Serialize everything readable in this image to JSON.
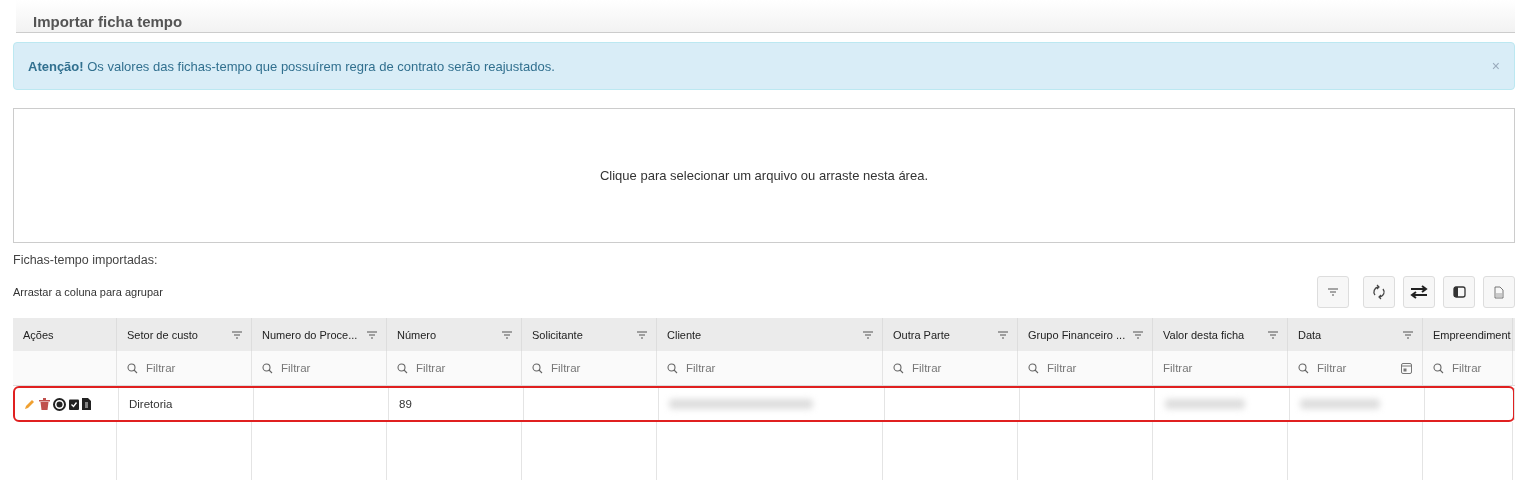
{
  "page_title": "Importar ficha tempo",
  "alert": {
    "strong": "Atenção!",
    "message": "Os valores das fichas-tempo que possuírem regra de contrato serão reajustados.",
    "close": "×"
  },
  "dropzone": {
    "text": "Clique para selecionar um arquivo ou arraste nesta área."
  },
  "section_label": "Fichas-tempo importadas:",
  "group_hint": "Arrastar a coluna para agrupar",
  "toolbar": [
    {
      "kind": "filter"
    },
    {
      "kind": "refresh"
    },
    {
      "kind": "swap"
    },
    {
      "kind": "columns"
    },
    {
      "kind": "export"
    }
  ],
  "table": {
    "columns": [
      {
        "label": "Ações",
        "menu": false
      },
      {
        "label": "Setor de custo",
        "menu": true,
        "search_icon": true,
        "calendar": false,
        "placeholder": "Filtrar"
      },
      {
        "label": "Numero do Proce...",
        "menu": true,
        "search_icon": true,
        "calendar": false,
        "placeholder": "Filtrar"
      },
      {
        "label": "Número",
        "menu": true,
        "search_icon": true,
        "calendar": false,
        "placeholder": "Filtrar"
      },
      {
        "label": "Solicitante",
        "menu": true,
        "search_icon": true,
        "calendar": false,
        "placeholder": "Filtrar"
      },
      {
        "label": "Cliente",
        "menu": true,
        "search_icon": true,
        "calendar": false,
        "placeholder": "Filtrar"
      },
      {
        "label": "Outra Parte",
        "menu": true,
        "search_icon": true,
        "calendar": false,
        "placeholder": "Filtrar"
      },
      {
        "label": "Grupo Financeiro ...",
        "menu": true,
        "search_icon": true,
        "calendar": false,
        "placeholder": "Filtrar"
      },
      {
        "label": "Valor desta ficha",
        "menu": true,
        "search_icon": false,
        "calendar": false,
        "placeholder": "Filtrar"
      },
      {
        "label": "Data",
        "menu": true,
        "search_icon": true,
        "calendar": true,
        "placeholder": "Filtrar"
      },
      {
        "label": "Empreendiment",
        "menu": false,
        "search_icon": true,
        "calendar": false,
        "placeholder": "Filtrar"
      }
    ],
    "rows": [
      {
        "highlighted": true,
        "cells": [
          {
            "kind": "actions",
            "actions": [
              {
                "kind": "edit"
              },
              {
                "kind": "delete"
              },
              {
                "kind": "block"
              },
              {
                "kind": "approve"
              },
              {
                "kind": "invoice"
              }
            ]
          },
          {
            "kind": "text",
            "text": "Diretoria"
          },
          {
            "kind": "empty"
          },
          {
            "kind": "text",
            "text": "89"
          },
          {
            "kind": "empty"
          },
          {
            "kind": "blurred"
          },
          {
            "kind": "empty"
          },
          {
            "kind": "empty"
          },
          {
            "kind": "blurred"
          },
          {
            "kind": "blurred"
          },
          {
            "kind": "empty"
          }
        ]
      }
    ]
  }
}
